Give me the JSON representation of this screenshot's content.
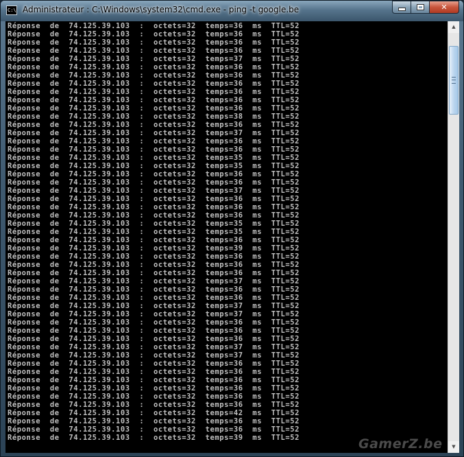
{
  "window": {
    "title": "Administrateur : C:\\Windows\\system32\\cmd.exe - ping  -t google.be",
    "icon_name": "cmd-icon",
    "icon_text": "C:\\",
    "minimize_label": "",
    "maximize_label": "",
    "close_label": "✕",
    "close_color": "#c8553c"
  },
  "console": {
    "text_color": "#c0c0c0",
    "background": "#000000",
    "template": {
      "prefix": "Réponse de 74.125.39.103 : octets=32 temps=",
      "suffix": " ms TTL=52"
    },
    "lines": [
      "Réponse de 74.125.39.103 : octets=32 temps=36 ms TTL=52",
      "Réponse de 74.125.39.103 : octets=32 temps=36 ms TTL=52",
      "Réponse de 74.125.39.103 : octets=32 temps=36 ms TTL=52",
      "Réponse de 74.125.39.103 : octets=32 temps=36 ms TTL=52",
      "Réponse de 74.125.39.103 : octets=32 temps=37 ms TTL=52",
      "Réponse de 74.125.39.103 : octets=32 temps=36 ms TTL=52",
      "Réponse de 74.125.39.103 : octets=32 temps=36 ms TTL=52",
      "Réponse de 74.125.39.103 : octets=32 temps=36 ms TTL=52",
      "Réponse de 74.125.39.103 : octets=32 temps=36 ms TTL=52",
      "Réponse de 74.125.39.103 : octets=32 temps=36 ms TTL=52",
      "Réponse de 74.125.39.103 : octets=32 temps=36 ms TTL=52",
      "Réponse de 74.125.39.103 : octets=32 temps=38 ms TTL=52",
      "Réponse de 74.125.39.103 : octets=32 temps=36 ms TTL=52",
      "Réponse de 74.125.39.103 : octets=32 temps=37 ms TTL=52",
      "Réponse de 74.125.39.103 : octets=32 temps=36 ms TTL=52",
      "Réponse de 74.125.39.103 : octets=32 temps=36 ms TTL=52",
      "Réponse de 74.125.39.103 : octets=32 temps=35 ms TTL=52",
      "Réponse de 74.125.39.103 : octets=32 temps=35 ms TTL=52",
      "Réponse de 74.125.39.103 : octets=32 temps=36 ms TTL=52",
      "Réponse de 74.125.39.103 : octets=32 temps=36 ms TTL=52",
      "Réponse de 74.125.39.103 : octets=32 temps=37 ms TTL=52",
      "Réponse de 74.125.39.103 : octets=32 temps=36 ms TTL=52",
      "Réponse de 74.125.39.103 : octets=32 temps=36 ms TTL=52",
      "Réponse de 74.125.39.103 : octets=32 temps=36 ms TTL=52",
      "Réponse de 74.125.39.103 : octets=32 temps=35 ms TTL=52",
      "Réponse de 74.125.39.103 : octets=32 temps=35 ms TTL=52",
      "Réponse de 74.125.39.103 : octets=32 temps=36 ms TTL=52",
      "Réponse de 74.125.39.103 : octets=32 temps=39 ms TTL=52",
      "Réponse de 74.125.39.103 : octets=32 temps=36 ms TTL=52",
      "Réponse de 74.125.39.103 : octets=32 temps=36 ms TTL=52",
      "Réponse de 74.125.39.103 : octets=32 temps=36 ms TTL=52",
      "Réponse de 74.125.39.103 : octets=32 temps=37 ms TTL=52",
      "Réponse de 74.125.39.103 : octets=32 temps=36 ms TTL=52",
      "Réponse de 74.125.39.103 : octets=32 temps=36 ms TTL=52",
      "Réponse de 74.125.39.103 : octets=32 temps=37 ms TTL=52",
      "Réponse de 74.125.39.103 : octets=32 temps=37 ms TTL=52",
      "Réponse de 74.125.39.103 : octets=32 temps=36 ms TTL=52",
      "Réponse de 74.125.39.103 : octets=32 temps=36 ms TTL=52",
      "Réponse de 74.125.39.103 : octets=32 temps=36 ms TTL=52",
      "Réponse de 74.125.39.103 : octets=32 temps=37 ms TTL=52",
      "Réponse de 74.125.39.103 : octets=32 temps=37 ms TTL=52",
      "Réponse de 74.125.39.103 : octets=32 temps=36 ms TTL=52",
      "Réponse de 74.125.39.103 : octets=32 temps=36 ms TTL=52",
      "Réponse de 74.125.39.103 : octets=32 temps=36 ms TTL=52",
      "Réponse de 74.125.39.103 : octets=32 temps=36 ms TTL=52",
      "Réponse de 74.125.39.103 : octets=32 temps=36 ms TTL=52",
      "Réponse de 74.125.39.103 : octets=32 temps=36 ms TTL=52",
      "Réponse de 74.125.39.103 : octets=32 temps=42 ms TTL=52",
      "Réponse de 74.125.39.103 : octets=32 temps=36 ms TTL=52",
      "Réponse de 74.125.39.103 : octets=32 temps=36 ms TTL=52",
      "Réponse de 74.125.39.103 : octets=32 temps=39 ms TTL=52"
    ]
  },
  "scrollbar": {
    "up_arrow": "▲",
    "down_arrow": "▼",
    "thumb_color": "#bcd6ee"
  },
  "watermark": {
    "text": "GamerZ.be"
  }
}
